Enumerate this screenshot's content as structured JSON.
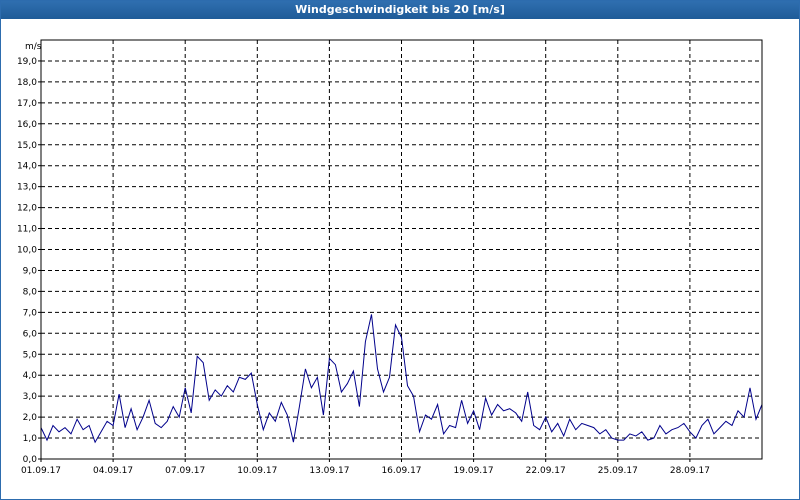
{
  "window": {
    "title": "Windgeschwindigkeit bis 20 [m/s]"
  },
  "chart_data": {
    "type": "line",
    "title": "Windgeschwindigkeit bis 20 [m/s]",
    "ylabel": "m/s",
    "xlabel": "",
    "ylim": [
      0,
      20
    ],
    "xlim": [
      "2017-09-01",
      "2017-10-01"
    ],
    "grid": true,
    "line_color": "#00008b",
    "y_ticks": [
      "0,0",
      "1,0",
      "2,0",
      "3,0",
      "4,0",
      "5,0",
      "6,0",
      "7,0",
      "8,0",
      "9,0",
      "10,0",
      "11,0",
      "12,0",
      "13,0",
      "14,0",
      "15,0",
      "16,0",
      "17,0",
      "18,0",
      "19,0"
    ],
    "x_tick_labels": [
      "01.09.17",
      "04.09.17",
      "07.09.17",
      "10.09.17",
      "13.09.17",
      "16.09.17",
      "19.09.17",
      "22.09.17",
      "25.09.17",
      "28.09.17"
    ],
    "x_tick_dates": [
      "2017-09-01",
      "2017-09-04",
      "2017-09-07",
      "2017-09-10",
      "2017-09-13",
      "2017-09-16",
      "2017-09-19",
      "2017-09-22",
      "2017-09-25",
      "2017-09-28"
    ],
    "series": [
      {
        "x": [
          "2017-09-01T00:00",
          "2017-09-01T06:00",
          "2017-09-01T12:00",
          "2017-09-01T18:00",
          "2017-09-02T00:00",
          "2017-09-02T06:00",
          "2017-09-02T12:00",
          "2017-09-02T18:00",
          "2017-09-03T00:00",
          "2017-09-03T06:00",
          "2017-09-03T12:00",
          "2017-09-03T18:00",
          "2017-09-04T00:00",
          "2017-09-04T06:00",
          "2017-09-04T12:00",
          "2017-09-04T18:00",
          "2017-09-05T00:00",
          "2017-09-05T06:00",
          "2017-09-05T12:00",
          "2017-09-05T18:00",
          "2017-09-06T00:00",
          "2017-09-06T06:00",
          "2017-09-06T12:00",
          "2017-09-06T18:00",
          "2017-09-07T00:00",
          "2017-09-07T06:00",
          "2017-09-07T12:00",
          "2017-09-07T18:00",
          "2017-09-08T00:00",
          "2017-09-08T06:00",
          "2017-09-08T12:00",
          "2017-09-08T18:00",
          "2017-09-09T00:00",
          "2017-09-09T06:00",
          "2017-09-09T12:00",
          "2017-09-09T18:00",
          "2017-09-10T00:00",
          "2017-09-10T06:00",
          "2017-09-10T12:00",
          "2017-09-10T18:00",
          "2017-09-11T00:00",
          "2017-09-11T06:00",
          "2017-09-11T12:00",
          "2017-09-11T18:00",
          "2017-09-12T00:00",
          "2017-09-12T06:00",
          "2017-09-12T12:00",
          "2017-09-12T18:00",
          "2017-09-13T00:00",
          "2017-09-13T06:00",
          "2017-09-13T12:00",
          "2017-09-13T18:00",
          "2017-09-14T00:00",
          "2017-09-14T06:00",
          "2017-09-14T12:00",
          "2017-09-14T18:00",
          "2017-09-15T00:00",
          "2017-09-15T06:00",
          "2017-09-15T12:00",
          "2017-09-15T18:00",
          "2017-09-16T00:00",
          "2017-09-16T06:00",
          "2017-09-16T12:00",
          "2017-09-16T18:00",
          "2017-09-17T00:00",
          "2017-09-17T06:00",
          "2017-09-17T12:00",
          "2017-09-17T18:00",
          "2017-09-18T00:00",
          "2017-09-18T06:00",
          "2017-09-18T12:00",
          "2017-09-18T18:00",
          "2017-09-19T00:00",
          "2017-09-19T06:00",
          "2017-09-19T12:00",
          "2017-09-19T18:00",
          "2017-09-20T00:00",
          "2017-09-20T06:00",
          "2017-09-20T12:00",
          "2017-09-20T18:00",
          "2017-09-21T00:00",
          "2017-09-21T06:00",
          "2017-09-21T12:00",
          "2017-09-21T18:00",
          "2017-09-22T00:00",
          "2017-09-22T06:00",
          "2017-09-22T12:00",
          "2017-09-22T18:00",
          "2017-09-23T00:00",
          "2017-09-23T06:00",
          "2017-09-23T12:00",
          "2017-09-23T18:00",
          "2017-09-24T00:00",
          "2017-09-24T06:00",
          "2017-09-24T12:00",
          "2017-09-24T18:00",
          "2017-09-25T00:00",
          "2017-09-25T06:00",
          "2017-09-25T12:00",
          "2017-09-25T18:00",
          "2017-09-26T00:00",
          "2017-09-26T06:00",
          "2017-09-26T12:00",
          "2017-09-26T18:00",
          "2017-09-27T00:00",
          "2017-09-27T06:00",
          "2017-09-27T12:00",
          "2017-09-27T18:00",
          "2017-09-28T00:00",
          "2017-09-28T06:00",
          "2017-09-28T12:00",
          "2017-09-28T18:00",
          "2017-09-29T00:00",
          "2017-09-29T06:00",
          "2017-09-29T12:00",
          "2017-09-29T18:00",
          "2017-09-30T00:00",
          "2017-09-30T06:00",
          "2017-09-30T12:00",
          "2017-09-30T18:00",
          "2017-10-01T00:00"
        ],
        "values": [
          1.5,
          0.9,
          1.6,
          1.3,
          1.5,
          1.2,
          1.9,
          1.4,
          1.6,
          0.8,
          1.3,
          1.8,
          1.6,
          3.1,
          1.5,
          2.4,
          1.4,
          2.0,
          2.8,
          1.7,
          1.5,
          1.8,
          2.5,
          2.0,
          3.4,
          2.2,
          4.9,
          4.6,
          2.8,
          3.3,
          3.0,
          3.5,
          3.2,
          3.9,
          3.8,
          4.1,
          2.6,
          1.4,
          2.2,
          1.8,
          2.7,
          2.1,
          0.8,
          2.5,
          4.3,
          3.4,
          3.9,
          2.1,
          4.8,
          4.5,
          3.2,
          3.6,
          4.2,
          2.5,
          5.6,
          6.9,
          4.3,
          3.2,
          3.9,
          6.4,
          5.8,
          3.5,
          3.0,
          1.3,
          2.1,
          1.9,
          2.6,
          1.2,
          1.6,
          1.5,
          2.8,
          1.7,
          2.3,
          1.4,
          2.9,
          2.1,
          2.6,
          2.3,
          2.4,
          2.2,
          1.8,
          3.2,
          1.6,
          1.4,
          2.0,
          1.3,
          1.7,
          1.1,
          1.9,
          1.4,
          1.7,
          1.6,
          1.5,
          1.2,
          1.4,
          1.0,
          0.9,
          0.9,
          1.2,
          1.1,
          1.3,
          0.9,
          1.0,
          1.6,
          1.2,
          1.4,
          1.5,
          1.7,
          1.3,
          1.0,
          1.6,
          1.9,
          1.2,
          1.5,
          1.8,
          1.6,
          2.3,
          2.0,
          3.4,
          1.9,
          2.6
        ]
      }
    ]
  }
}
